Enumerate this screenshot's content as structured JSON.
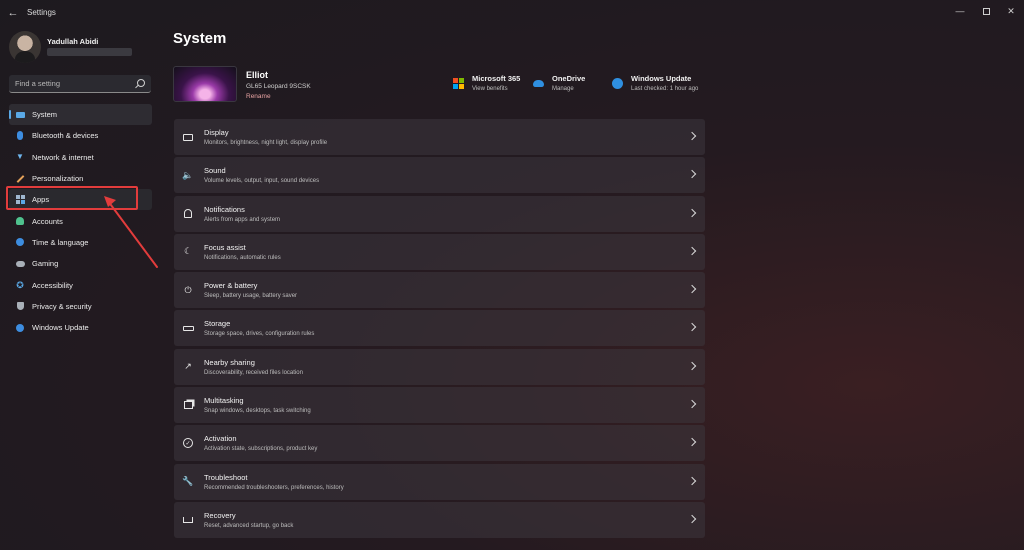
{
  "window": {
    "title": "Settings"
  },
  "profile": {
    "name": "Yadullah Abidi"
  },
  "search": {
    "placeholder": "Find a setting"
  },
  "sidebar": {
    "items": [
      {
        "label": "System",
        "icon": "monitor-icon"
      },
      {
        "label": "Bluetooth & devices",
        "icon": "bluetooth-icon"
      },
      {
        "label": "Network & internet",
        "icon": "wifi-icon"
      },
      {
        "label": "Personalization",
        "icon": "brush-icon"
      },
      {
        "label": "Apps",
        "icon": "apps-icon"
      },
      {
        "label": "Accounts",
        "icon": "person-icon"
      },
      {
        "label": "Time & language",
        "icon": "globe-clock-icon"
      },
      {
        "label": "Gaming",
        "icon": "gamepad-icon"
      },
      {
        "label": "Accessibility",
        "icon": "accessibility-icon"
      },
      {
        "label": "Privacy & security",
        "icon": "shield-icon"
      },
      {
        "label": "Windows Update",
        "icon": "update-icon"
      }
    ]
  },
  "main": {
    "title": "System",
    "device": {
      "name": "Elliot",
      "model": "GL65 Leopard 9SCSK",
      "rename_label": "Rename"
    },
    "quick_links": [
      {
        "title": "Microsoft 365",
        "subtitle": "View benefits",
        "icon": "microsoft-icon"
      },
      {
        "title": "OneDrive",
        "subtitle": "Manage",
        "icon": "cloud-icon"
      },
      {
        "title": "Windows Update",
        "subtitle": "Last checked: 1 hour ago",
        "icon": "update-icon"
      }
    ],
    "settings": [
      {
        "title": "Display",
        "subtitle": "Monitors, brightness, night light, display profile",
        "icon": "display-icon"
      },
      {
        "title": "Sound",
        "subtitle": "Volume levels, output, input, sound devices",
        "icon": "speaker-icon"
      },
      {
        "title": "Notifications",
        "subtitle": "Alerts from apps and system",
        "icon": "bell-icon"
      },
      {
        "title": "Focus assist",
        "subtitle": "Notifications, automatic rules",
        "icon": "moon-icon"
      },
      {
        "title": "Power & battery",
        "subtitle": "Sleep, battery usage, battery saver",
        "icon": "power-icon"
      },
      {
        "title": "Storage",
        "subtitle": "Storage space, drives, configuration rules",
        "icon": "storage-icon"
      },
      {
        "title": "Nearby sharing",
        "subtitle": "Discoverability, received files location",
        "icon": "share-icon"
      },
      {
        "title": "Multitasking",
        "subtitle": "Snap windows, desktops, task switching",
        "icon": "multitask-icon"
      },
      {
        "title": "Activation",
        "subtitle": "Activation state, subscriptions, product key",
        "icon": "check-circle-icon"
      },
      {
        "title": "Troubleshoot",
        "subtitle": "Recommended troubleshooters, preferences, history",
        "icon": "wrench-icon"
      },
      {
        "title": "Recovery",
        "subtitle": "Reset, advanced startup, go back",
        "icon": "recovery-icon"
      }
    ]
  },
  "colors": {
    "accent": "#5aa9e6",
    "highlight": "#e23c3c"
  }
}
